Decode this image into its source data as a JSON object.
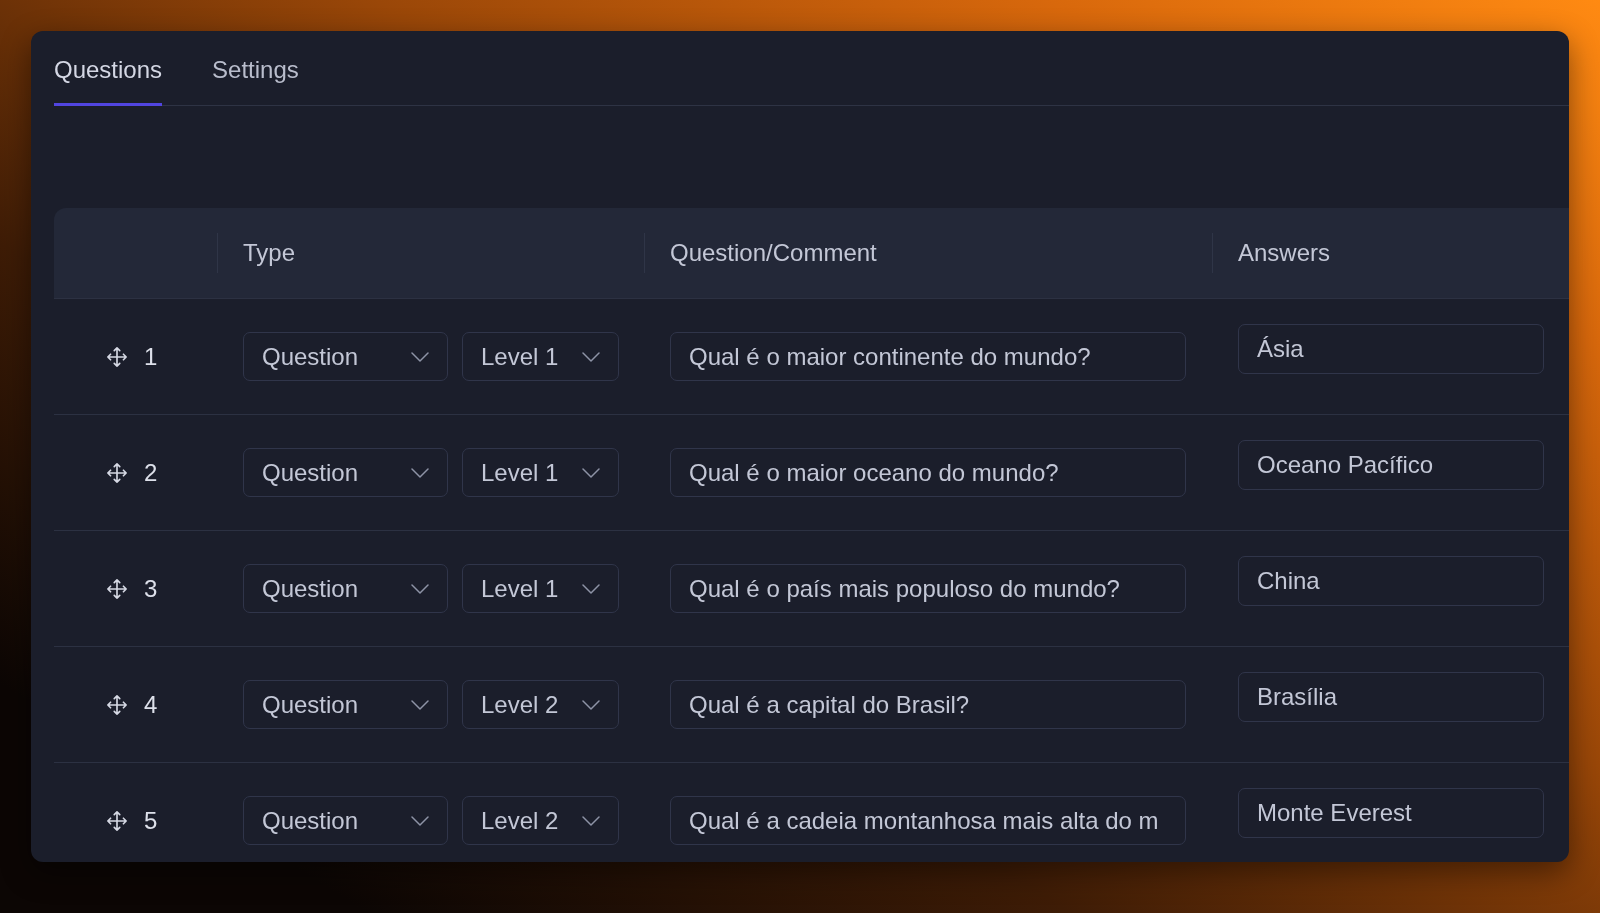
{
  "tabs": [
    {
      "label": "Questions",
      "selected": true
    },
    {
      "label": "Settings",
      "selected": false
    }
  ],
  "table": {
    "columns": [
      "Type",
      "Question/Comment",
      "Answers"
    ],
    "rows": [
      {
        "number": "1",
        "type": "Question",
        "level": "Level 1",
        "question": "Qual é o maior continente do mundo?",
        "answer": "Ásia"
      },
      {
        "number": "2",
        "type": "Question",
        "level": "Level 1",
        "question": "Qual é o maior oceano do mundo?",
        "answer": "Oceano Pacífico"
      },
      {
        "number": "3",
        "type": "Question",
        "level": "Level 1",
        "question": "Qual é o país mais populoso do mundo?",
        "answer": "China"
      },
      {
        "number": "4",
        "type": "Question",
        "level": "Level 2",
        "question": "Qual é a capital do Brasil?",
        "answer": "Brasília"
      },
      {
        "number": "5",
        "type": "Question",
        "level": "Level 2",
        "question": "Qual é a cadeia montanhosa mais alta do m",
        "answer": "Monte Everest"
      }
    ]
  }
}
